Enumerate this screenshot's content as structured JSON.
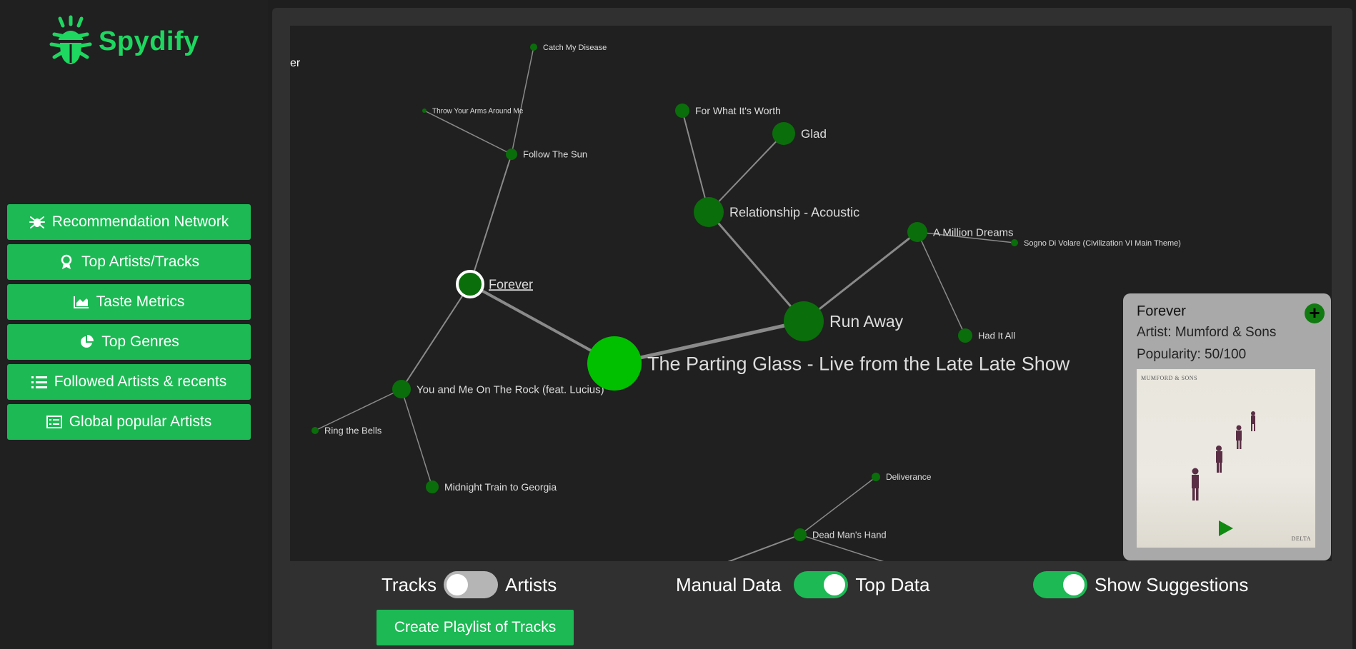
{
  "app": {
    "name": "Spydify",
    "brand_color": "#1ed760",
    "accent": "#1db954"
  },
  "nav": [
    {
      "label": "Recommendation Network",
      "icon": "spider-icon"
    },
    {
      "label": "Top Artists/Tracks",
      "icon": "award-icon"
    },
    {
      "label": "Taste Metrics",
      "icon": "area-chart-icon"
    },
    {
      "label": "Top Genres",
      "icon": "pie-chart-icon"
    },
    {
      "label": "Followed Artists & recents",
      "icon": "list-icon"
    },
    {
      "label": "Global popular Artists",
      "icon": "table-list-icon"
    }
  ],
  "graph": {
    "partial_label": "er",
    "nodes": [
      {
        "id": "catch",
        "label": "Catch My Disease"
      },
      {
        "id": "throw",
        "label": "Throw Your Arms Around Me"
      },
      {
        "id": "follow",
        "label": "Follow The Sun"
      },
      {
        "id": "forever",
        "label": "Forever",
        "selected": true
      },
      {
        "id": "youme",
        "label": "You and Me On The Rock (feat. Lucius)"
      },
      {
        "id": "ring",
        "label": "Ring the Bells"
      },
      {
        "id": "midnight",
        "label": "Midnight Train to Georgia"
      },
      {
        "id": "parting",
        "label": "The Parting Glass - Live from the Late Late Show"
      },
      {
        "id": "runaway",
        "label": "Run Away"
      },
      {
        "id": "relationship",
        "label": "Relationship - Acoustic"
      },
      {
        "id": "worth",
        "label": "For What It's Worth"
      },
      {
        "id": "glad",
        "label": "Glad"
      },
      {
        "id": "million",
        "label": "A Million Dreams"
      },
      {
        "id": "sogno",
        "label": "Sogno Di Volare (Civilization VI Main Theme)"
      },
      {
        "id": "hadit",
        "label": "Had It All"
      },
      {
        "id": "deliverance",
        "label": "Deliverance"
      },
      {
        "id": "deadman",
        "label": "Dead Man's Hand"
      }
    ]
  },
  "card": {
    "title": "Forever",
    "artist": "Artist: Mumford & Sons",
    "popularity": "Popularity: 50/100",
    "album_band": "MUMFORD & SONS",
    "album_title": "DELTA"
  },
  "controls": {
    "tracks": "Tracks",
    "artists": "Artists",
    "manual": "Manual Data",
    "top": "Top Data",
    "suggestions": "Show Suggestions",
    "create": "Create Playlist of Tracks"
  }
}
